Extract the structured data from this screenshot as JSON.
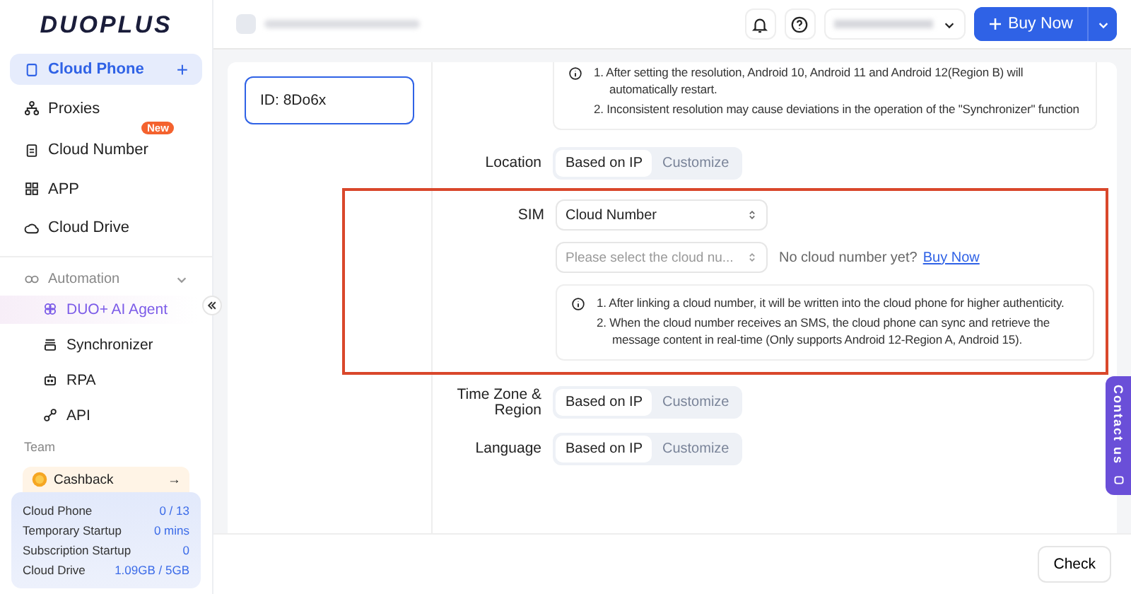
{
  "logo": "DUOPLUS",
  "nav": [
    {
      "label": "Cloud Phone",
      "selected": true,
      "plus": "+"
    },
    {
      "label": "Proxies",
      "selected": false
    },
    {
      "label": "Cloud Number",
      "selected": false,
      "badge": "New"
    },
    {
      "label": "APP",
      "selected": false
    },
    {
      "label": "Cloud Drive",
      "selected": false
    }
  ],
  "automation": {
    "label": "Automation",
    "expanded": true,
    "items": [
      {
        "label": "DUO+ AI Agent",
        "selected": true
      },
      {
        "label": "Synchronizer",
        "selected": false
      },
      {
        "label": "RPA",
        "selected": false
      },
      {
        "label": "API",
        "selected": false
      }
    ]
  },
  "team": {
    "label": "Team"
  },
  "cashback": {
    "label": "Cashback",
    "arrow": "→"
  },
  "usage": [
    {
      "label": "Cloud Phone",
      "value": "0 / 13"
    },
    {
      "label": "Temporary Startup",
      "value": "0 mins"
    },
    {
      "label": "Subscription Startup",
      "value": "0"
    },
    {
      "label": "Cloud Drive",
      "value": "1.09GB / 5GB"
    }
  ],
  "header": {
    "buy_label": "Buy Now"
  },
  "device": {
    "id": "ID: 8Do6x",
    "selected": true
  },
  "resolution_notes": [
    "1. After setting the resolution, Android 10, Android 11 and Android 12(Region B) will automatically restart.",
    "2. Inconsistent resolution may cause deviations in the operation of the \"Synchronizer\" function"
  ],
  "location": {
    "label": "Location",
    "options": [
      {
        "label": "Based on IP",
        "selected": true
      },
      {
        "label": "Customize",
        "selected": false
      }
    ]
  },
  "sim": {
    "label": "SIM",
    "highlighted": true,
    "type_value": "Cloud Number",
    "number_placeholder": "Please select the cloud nu...",
    "hint": "No cloud number yet?",
    "link": "Buy Now",
    "notes": [
      "1. After linking a cloud number, it will be written into the cloud phone for higher authenticity.",
      "2. When the cloud number receives an SMS, the cloud phone can sync and retrieve the message content in real-time (Only supports Android 12-Region A, Android 15)."
    ]
  },
  "timezone": {
    "label": "Time Zone & Region",
    "options": [
      {
        "label": "Based on IP",
        "selected": true
      },
      {
        "label": "Customize",
        "selected": false
      }
    ]
  },
  "language": {
    "label": "Language",
    "options": [
      {
        "label": "Based on IP",
        "selected": true
      },
      {
        "label": "Customize",
        "selected": false
      }
    ]
  },
  "contact": "Contact us",
  "check_button": "Check"
}
